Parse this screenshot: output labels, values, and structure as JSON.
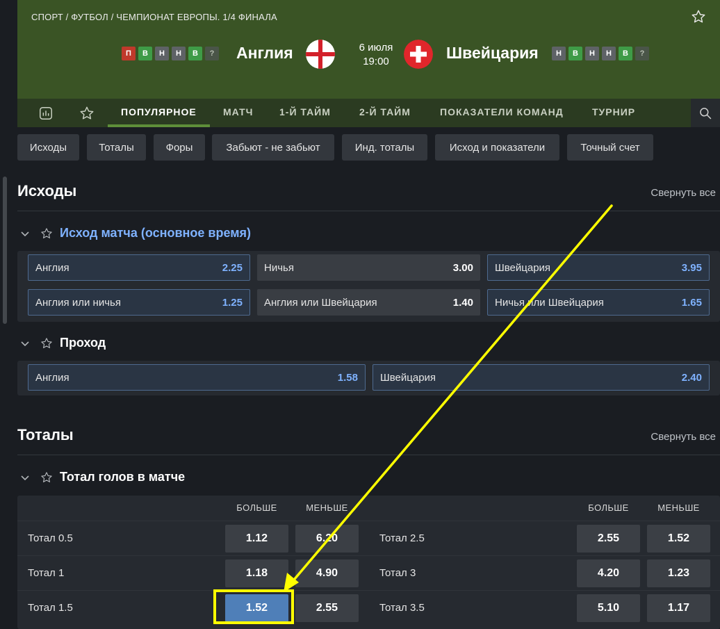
{
  "header": {
    "breadcrumb": "СПОРТ / ФУТБОЛ / ЧЕМПИОНАТ ЕВРОПЫ. 1/4 ФИНАЛА",
    "date": "6 июля",
    "time": "19:00",
    "home": {
      "name": "Англия",
      "form": [
        {
          "letter": "П",
          "color": "#c0392b"
        },
        {
          "letter": "В",
          "color": "#3f9b47"
        },
        {
          "letter": "Н",
          "color": "#5e6266"
        },
        {
          "letter": "Н",
          "color": "#5e6266"
        },
        {
          "letter": "В",
          "color": "#3f9b47"
        },
        {
          "letter": "?",
          "color": "#4a5548"
        }
      ]
    },
    "away": {
      "name": "Швейцария",
      "form": [
        {
          "letter": "Н",
          "color": "#5e6266"
        },
        {
          "letter": "В",
          "color": "#3f9b47"
        },
        {
          "letter": "Н",
          "color": "#5e6266"
        },
        {
          "letter": "Н",
          "color": "#5e6266"
        },
        {
          "letter": "В",
          "color": "#3f9b47"
        },
        {
          "letter": "?",
          "color": "#4a5548"
        }
      ]
    }
  },
  "nav": {
    "tabs": [
      "ПОПУЛЯРНОЕ",
      "МАТЧ",
      "1-Й ТАЙМ",
      "2-Й ТАЙМ",
      "ПОКАЗАТЕЛИ КОМАНД",
      "ТУРНИР"
    ]
  },
  "chips": [
    "Исходы",
    "Тоталы",
    "Форы",
    "Забьют - не забьют",
    "Инд. тоталы",
    "Исход и показатели",
    "Точный счет"
  ],
  "outcomes": {
    "title": "Исходы",
    "collapse": "Свернуть все",
    "match_result": {
      "title": "Исход матча (основное время)",
      "odds": [
        {
          "label": "Англия",
          "value": "2.25"
        },
        {
          "label": "Ничья",
          "value": "3.00"
        },
        {
          "label": "Швейцария",
          "value": "3.95"
        },
        {
          "label": "Англия или ничья",
          "value": "1.25"
        },
        {
          "label": "Англия или Швейцария",
          "value": "1.40"
        },
        {
          "label": "Ничья или Швейцария",
          "value": "1.65"
        }
      ]
    },
    "qualify": {
      "title": "Проход",
      "odds": [
        {
          "label": "Англия",
          "value": "1.58"
        },
        {
          "label": "Швейцария",
          "value": "2.40"
        }
      ]
    }
  },
  "totals": {
    "title": "Тоталы",
    "collapse": "Свернуть все",
    "market": {
      "title": "Тотал голов в матче",
      "over": "БОЛЬШЕ",
      "under": "МЕНЬШЕ",
      "rows": [
        {
          "left": {
            "label": "Тотал 0.5",
            "over": "1.12",
            "under": "6.20"
          },
          "right": {
            "label": "Тотал 2.5",
            "over": "2.55",
            "under": "1.52"
          }
        },
        {
          "left": {
            "label": "Тотал 1",
            "over": "1.18",
            "under": "4.90"
          },
          "right": {
            "label": "Тотал 3",
            "over": "4.20",
            "under": "1.23"
          }
        },
        {
          "left": {
            "label": "Тотал 1.5",
            "over": "1.52",
            "under": "2.55"
          },
          "right": {
            "label": "Тотал 3.5",
            "over": "5.10",
            "under": "1.17"
          }
        }
      ]
    }
  },
  "annotation_color": "#ffff00"
}
